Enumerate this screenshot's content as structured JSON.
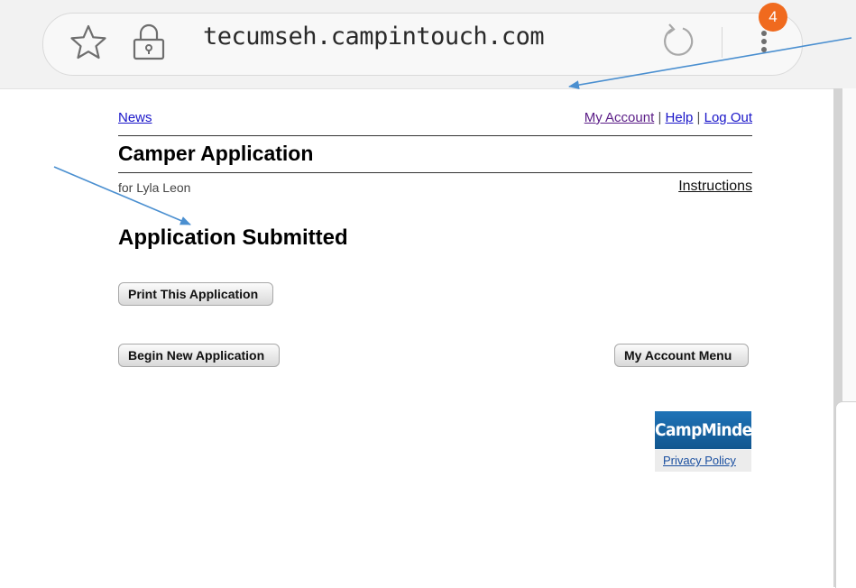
{
  "browser": {
    "url": "tecumseh.campintouch.com",
    "notification_count": "4",
    "icons": [
      "star-icon",
      "lock-icon",
      "reload-icon",
      "overflow-menu-icon"
    ]
  },
  "nav": {
    "news": "News",
    "my_account": "My Account",
    "separator": "|",
    "help": "Help",
    "log_out": "Log Out"
  },
  "page": {
    "title": "Camper Application",
    "camper": "for Lyla Leon",
    "instructions": "Instructions",
    "status_heading": "Application Submitted"
  },
  "buttons": {
    "print": "Print This Application",
    "begin_new": "Begin New Application",
    "account_menu": "My Account Menu"
  },
  "footer": {
    "logo": "CampMinder",
    "privacy": "Privacy Policy"
  },
  "colors": {
    "annotation_arrow": "#4a8fd0",
    "badge": "#f06a1e",
    "link": "#1a16c9",
    "visited_link": "#5a1b86",
    "logo_bg": "#1f73b7"
  }
}
